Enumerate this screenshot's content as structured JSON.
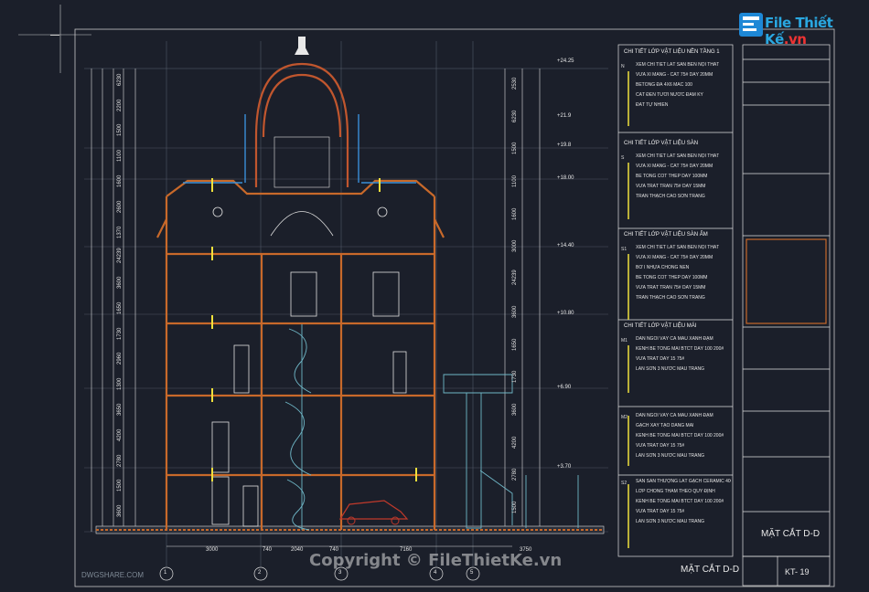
{
  "watermark": {
    "brand_a": "File",
    "brand_b": "Thiết Kế",
    "brand_c": ".vn",
    "bottom": "Copyright © FileThietKe.vn",
    "dwg": "DWGSHARE.COM"
  },
  "drawing": {
    "title": "MẶT CẮT D-D",
    "title_block_title": "MẶT CẮT D-D",
    "sheet_code": "KT- 19"
  },
  "elevations": [
    "+24.25",
    "+21.9",
    "+19.8",
    "+18.00",
    "+14.40",
    "+10.80",
    "+6.90",
    "+3.70"
  ],
  "left_dims": [
    "6230",
    "2200",
    "1500",
    "1100",
    "1600",
    "2600",
    "1370",
    "24239",
    "3600",
    "1650",
    "1730",
    "2960",
    "1300",
    "3650",
    "4200",
    "2780",
    "1500",
    "3600"
  ],
  "right_dims": [
    "2530",
    "6230",
    "1500",
    "1100",
    "1600",
    "3000",
    "24239",
    "3600",
    "1650",
    "1730",
    "3600",
    "4200",
    "2780",
    "1500"
  ],
  "bottom_dims": [
    "3000",
    "740",
    "2040",
    "740",
    "7160",
    "3750"
  ],
  "grid_labels": [
    "1",
    "2",
    "3",
    "4",
    "5"
  ],
  "legend": [
    {
      "title": "CHI TIẾT LỚP VẬT LIỆU NỀN TẦNG 1",
      "marker": "N",
      "items": [
        "XEM CHI TIẾT LÁT SÀN BÊN NỘI THẤT",
        "VỮA XI MĂNG - CÁT 75# DÀY 20MM",
        "BÊTÔNG ĐÁ 4X6 MÁC 100",
        "CÁT ĐEN TƯỚI NƯỚC ĐẦM KỸ",
        "ĐẤT TỰ NHIÊN"
      ]
    },
    {
      "title": "CHI TIẾT LỚP VẬT LIỆU SÀN",
      "marker": "S",
      "items": [
        "XEM CHI TIẾT LÁT SÀN BÊN NỘI THẤT",
        "VỮA XI MĂNG - CÁT 75# DÀY 20MM",
        "BÊ TÔNG CỐT THÉP DÀY 100MM",
        "VỮA TRÁT TRẦN 75# DÀY 15MM",
        "TRẦN THẠCH CAO SƠN TRẮNG"
      ]
    },
    {
      "title": "CHI TIẾT LỚP VẬT LIỆU SÀN ẨM",
      "marker": "S1",
      "items": [
        "XEM CHI TIẾT LÁT SÀN BÊN NỘI THẤT",
        "VỮA XI MĂNG - CÁT 75# DÀY 20MM",
        "BƠ I NHỰA CHỐNG NỀN",
        "BÊ TÔNG CỐT THÉP DÀY 100MM",
        "VỮA TRÁT TRẦN 75# DÀY 15MM",
        "TRẦN THẠCH CAO SƠN TRẮNG"
      ]
    },
    {
      "title": "CHI TIẾT LỚP VẬT LIỆU MÁI",
      "marker": "M1",
      "items": [
        "DÁN NGÓI VẢY CÁ MÀU XANH ĐẬM",
        "KÊNH BÊ TÔNG MÁI BTCT DÀY 100 200#",
        "VỮA TRÁT DÀY 15 75#",
        "LĂN SƠN 3 NƯỚC MÀU TRẮNG"
      ]
    },
    {
      "title": "",
      "marker": "M2",
      "items": [
        "DÁN NGÓI VẢY CÁ MÀU XANH ĐẬM",
        "GẠCH XÂY TẠO DÁNG MÁI",
        "KÊNH BÊ TÔNG MÁI BTCT DÀY 100 200#",
        "VỮA TRÁT DÀY 15 75#",
        "LĂN SƠN 3 NƯỚC MÀU TRẮNG"
      ]
    },
    {
      "title": "",
      "marker": "S2",
      "items": [
        "SÀN SÂN THƯỢNG LÁT GẠCH CERAMIC 400X400",
        "LỚP CHỐNG THẤM THEO QUY ĐỊNH",
        "KÊNH BÊ TÔNG MÁI BTCT DÀY 100 200#",
        "VỮA TRÁT DÀY 15 75#",
        "LĂN SƠN 3 NƯỚC MÀU TRẮNG"
      ]
    }
  ],
  "colors": {
    "background": "#1b1f2a",
    "structure": "#c8692a",
    "dome": "#c0562e",
    "line": "#e7e7e7",
    "accent_blue": "#3a8fd8",
    "accent_yellow": "#f0e03c",
    "stair": "#6fb7c7",
    "car": "#c0392b"
  }
}
